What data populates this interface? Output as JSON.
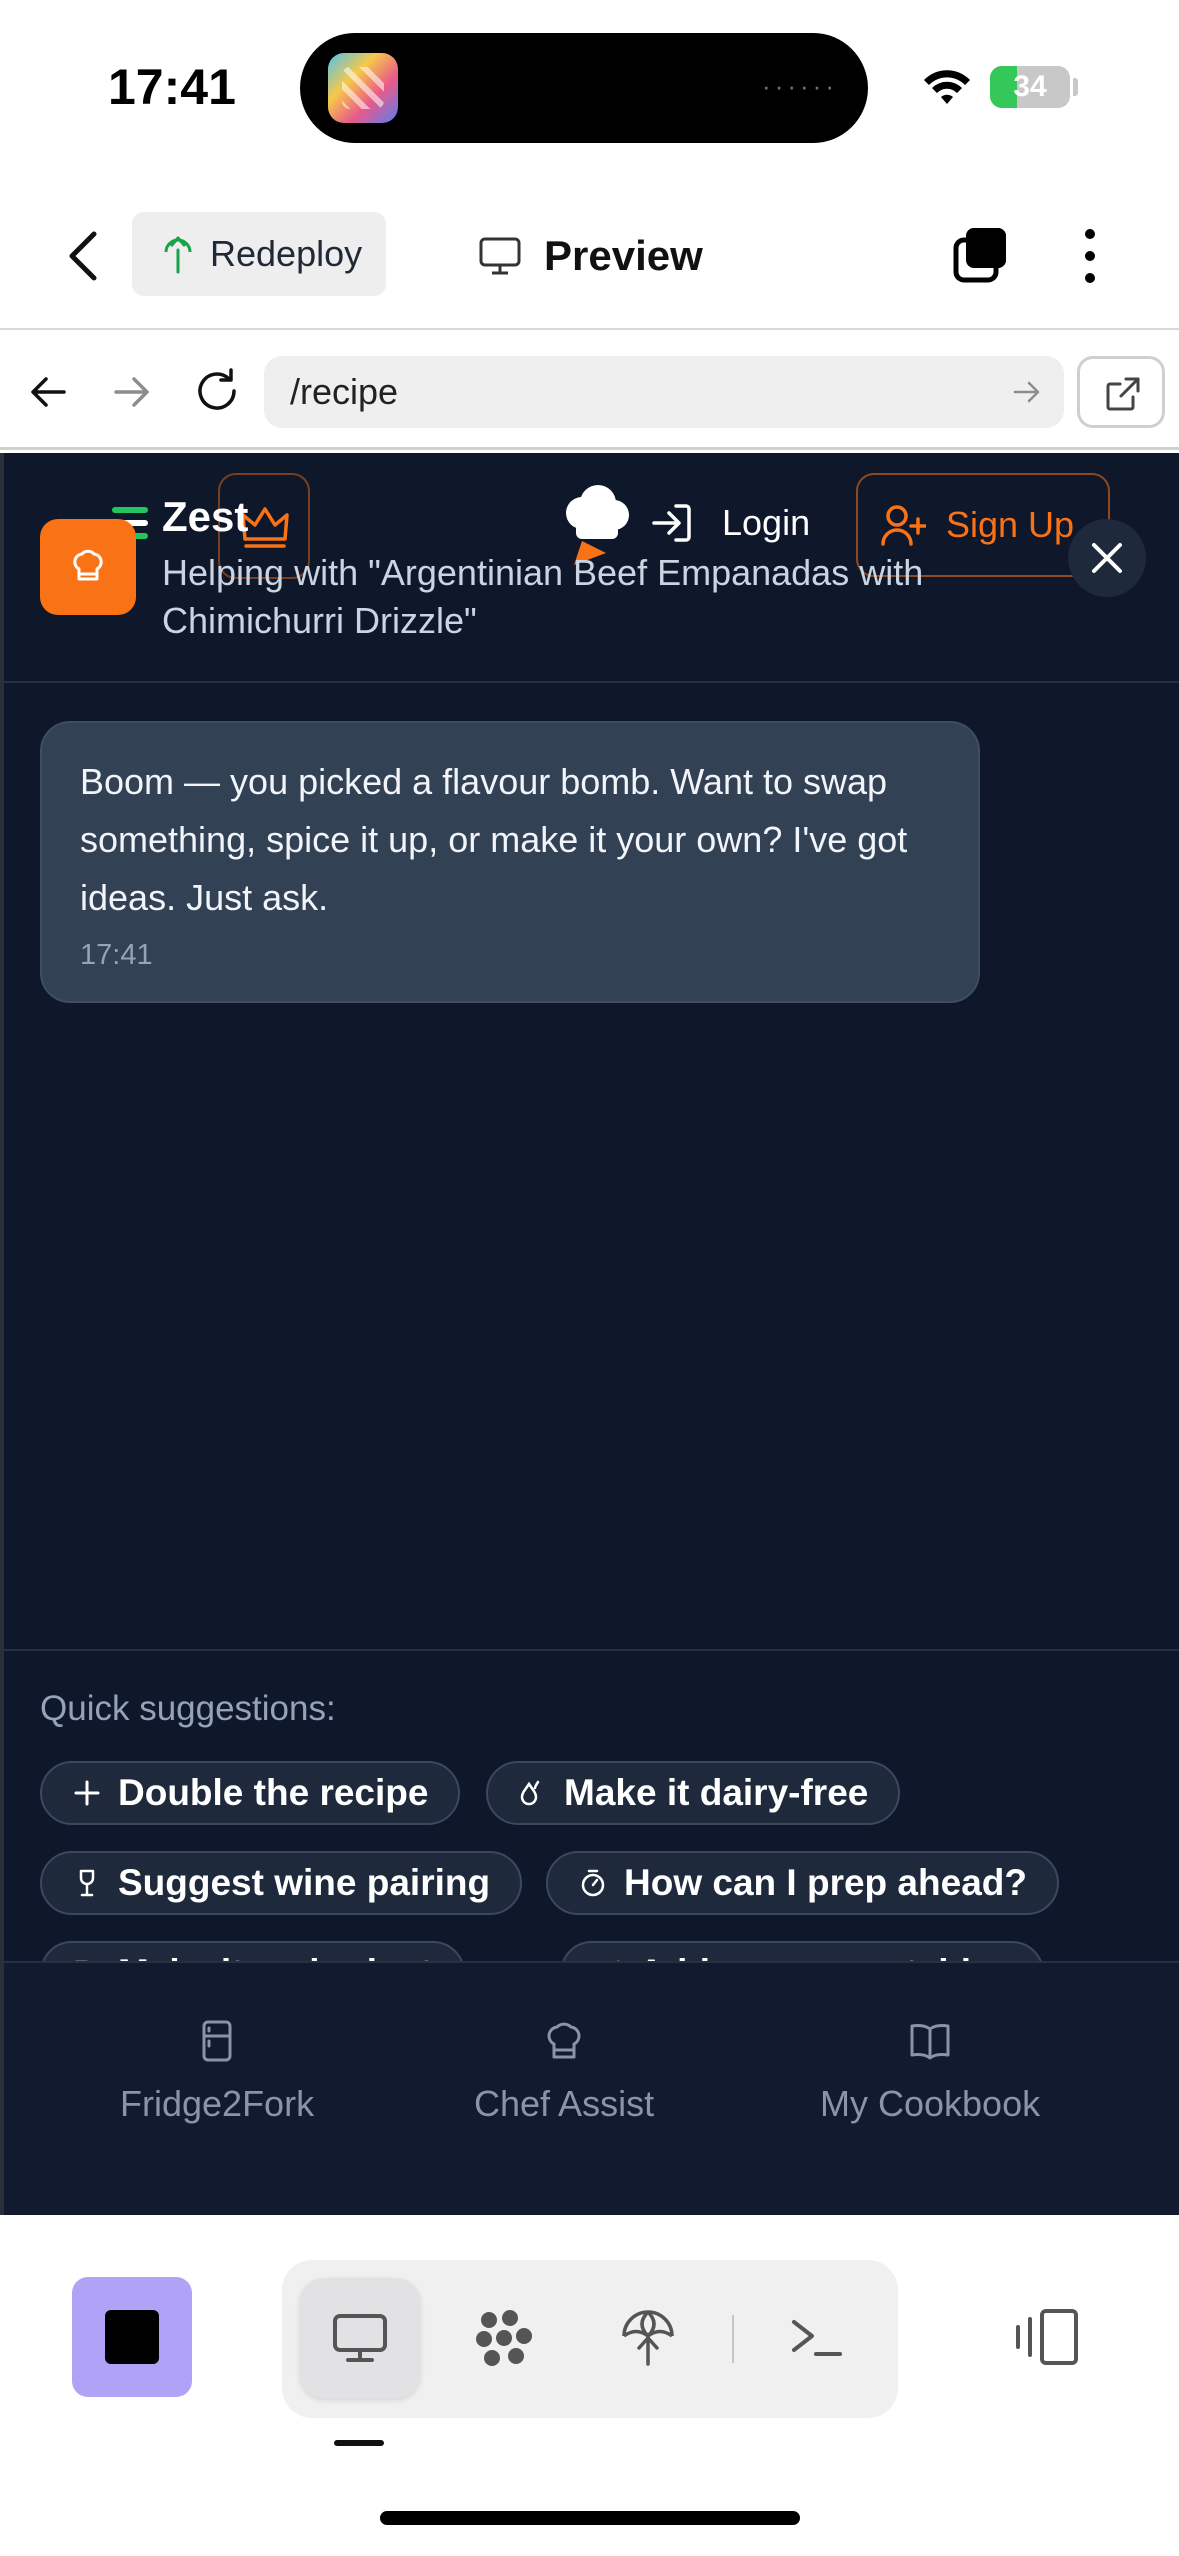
{
  "status_bar": {
    "time": "17:41",
    "battery": "34",
    "battery_level": 0.34
  },
  "toolbar": {
    "redeploy_label": "Redeploy",
    "preview_label": "Preview"
  },
  "browser": {
    "url": "/recipe"
  },
  "site": {
    "login_label": "Login",
    "signup_label": "Sign Up"
  },
  "assistant": {
    "name": "Zest",
    "subtitle": "Helping with \"Argentinian Beef Empanadas with Chimichurri Drizzle\""
  },
  "chat": {
    "messages": [
      {
        "text": "Boom — you picked a flavour bomb. Want to swap something, spice it up, or make it your own? I've got ideas. Just ask.",
        "time": "17:41"
      }
    ]
  },
  "suggestions": {
    "title": "Quick suggestions:",
    "chips": [
      {
        "label": "Double the recipe",
        "icon": "plus-icon"
      },
      {
        "label": "Make it dairy-free",
        "icon": "droplet-icon"
      },
      {
        "label": "Suggest wine pairing",
        "icon": "wine-icon"
      },
      {
        "label": "How can I prep ahead?",
        "icon": "timer-icon"
      },
      {
        "label": "Make it on budget",
        "icon": "tag-icon"
      },
      {
        "label": "Add more vegetables",
        "icon": "leaf-icon"
      }
    ]
  },
  "bottom_nav": {
    "items": [
      {
        "label": "Fridge2Fork",
        "icon": "fridge-icon"
      },
      {
        "label": "Chef Assist",
        "icon": "chef-hat-icon"
      },
      {
        "label": "My Cookbook",
        "icon": "book-icon"
      }
    ]
  },
  "colors": {
    "accent": "#f97316",
    "page_bg": "#0f172a",
    "bubble_bg": "#334155",
    "stop_bg": "#b0a2f7"
  }
}
